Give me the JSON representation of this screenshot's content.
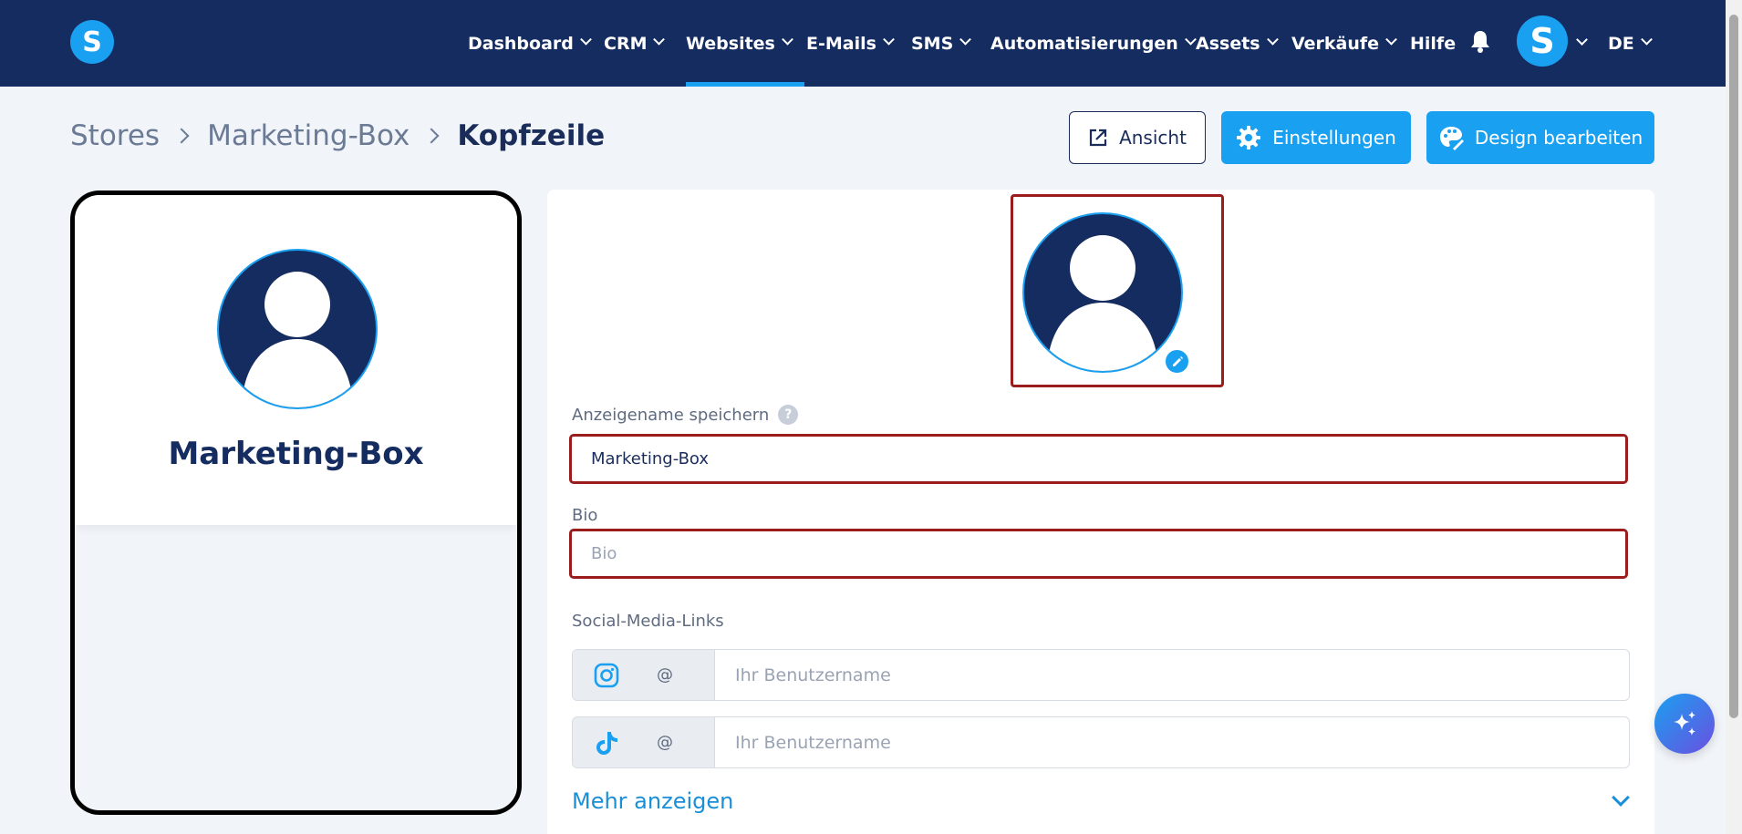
{
  "nav": {
    "logo_letter": "S",
    "items": [
      {
        "label": "Dashboard",
        "has_dropdown": true,
        "active": false
      },
      {
        "label": "CRM",
        "has_dropdown": true,
        "active": false
      },
      {
        "label": "Websites",
        "has_dropdown": true,
        "active": true
      },
      {
        "label": "E-Mails",
        "has_dropdown": true,
        "active": false
      },
      {
        "label": "SMS",
        "has_dropdown": true,
        "active": false
      },
      {
        "label": "Automatisierungen",
        "has_dropdown": true,
        "active": false
      },
      {
        "label": "Assets",
        "has_dropdown": true,
        "active": false
      },
      {
        "label": "Verkäufe",
        "has_dropdown": true,
        "active": false
      },
      {
        "label": "Hilfe",
        "has_dropdown": false,
        "active": false
      }
    ],
    "avatar_letter": "S",
    "language": "DE"
  },
  "breadcrumb": {
    "items": [
      "Stores",
      "Marketing-Box"
    ],
    "current": "Kopfzeile"
  },
  "actions": {
    "view_label": "Ansicht",
    "settings_label": "Einstellungen",
    "design_label": "Design bearbeiten"
  },
  "preview": {
    "name": "Marketing-Box"
  },
  "form": {
    "display_name_label": "Anzeigename speichern",
    "help_symbol": "?",
    "display_name_value": "Marketing-Box",
    "bio_label": "Bio",
    "bio_placeholder": "Bio",
    "social_label": "Social-Media-Links",
    "social_links": [
      {
        "icon": "instagram-icon",
        "prefix": "@",
        "placeholder": "Ihr Benutzername"
      },
      {
        "icon": "tiktok-icon",
        "prefix": "@",
        "placeholder": "Ihr Benutzername"
      }
    ],
    "show_more_label": "Mehr anzeigen"
  },
  "colors": {
    "navbar": "#152c61",
    "accent": "#1aa0f0",
    "highlight_border": "#9b1c1c"
  }
}
